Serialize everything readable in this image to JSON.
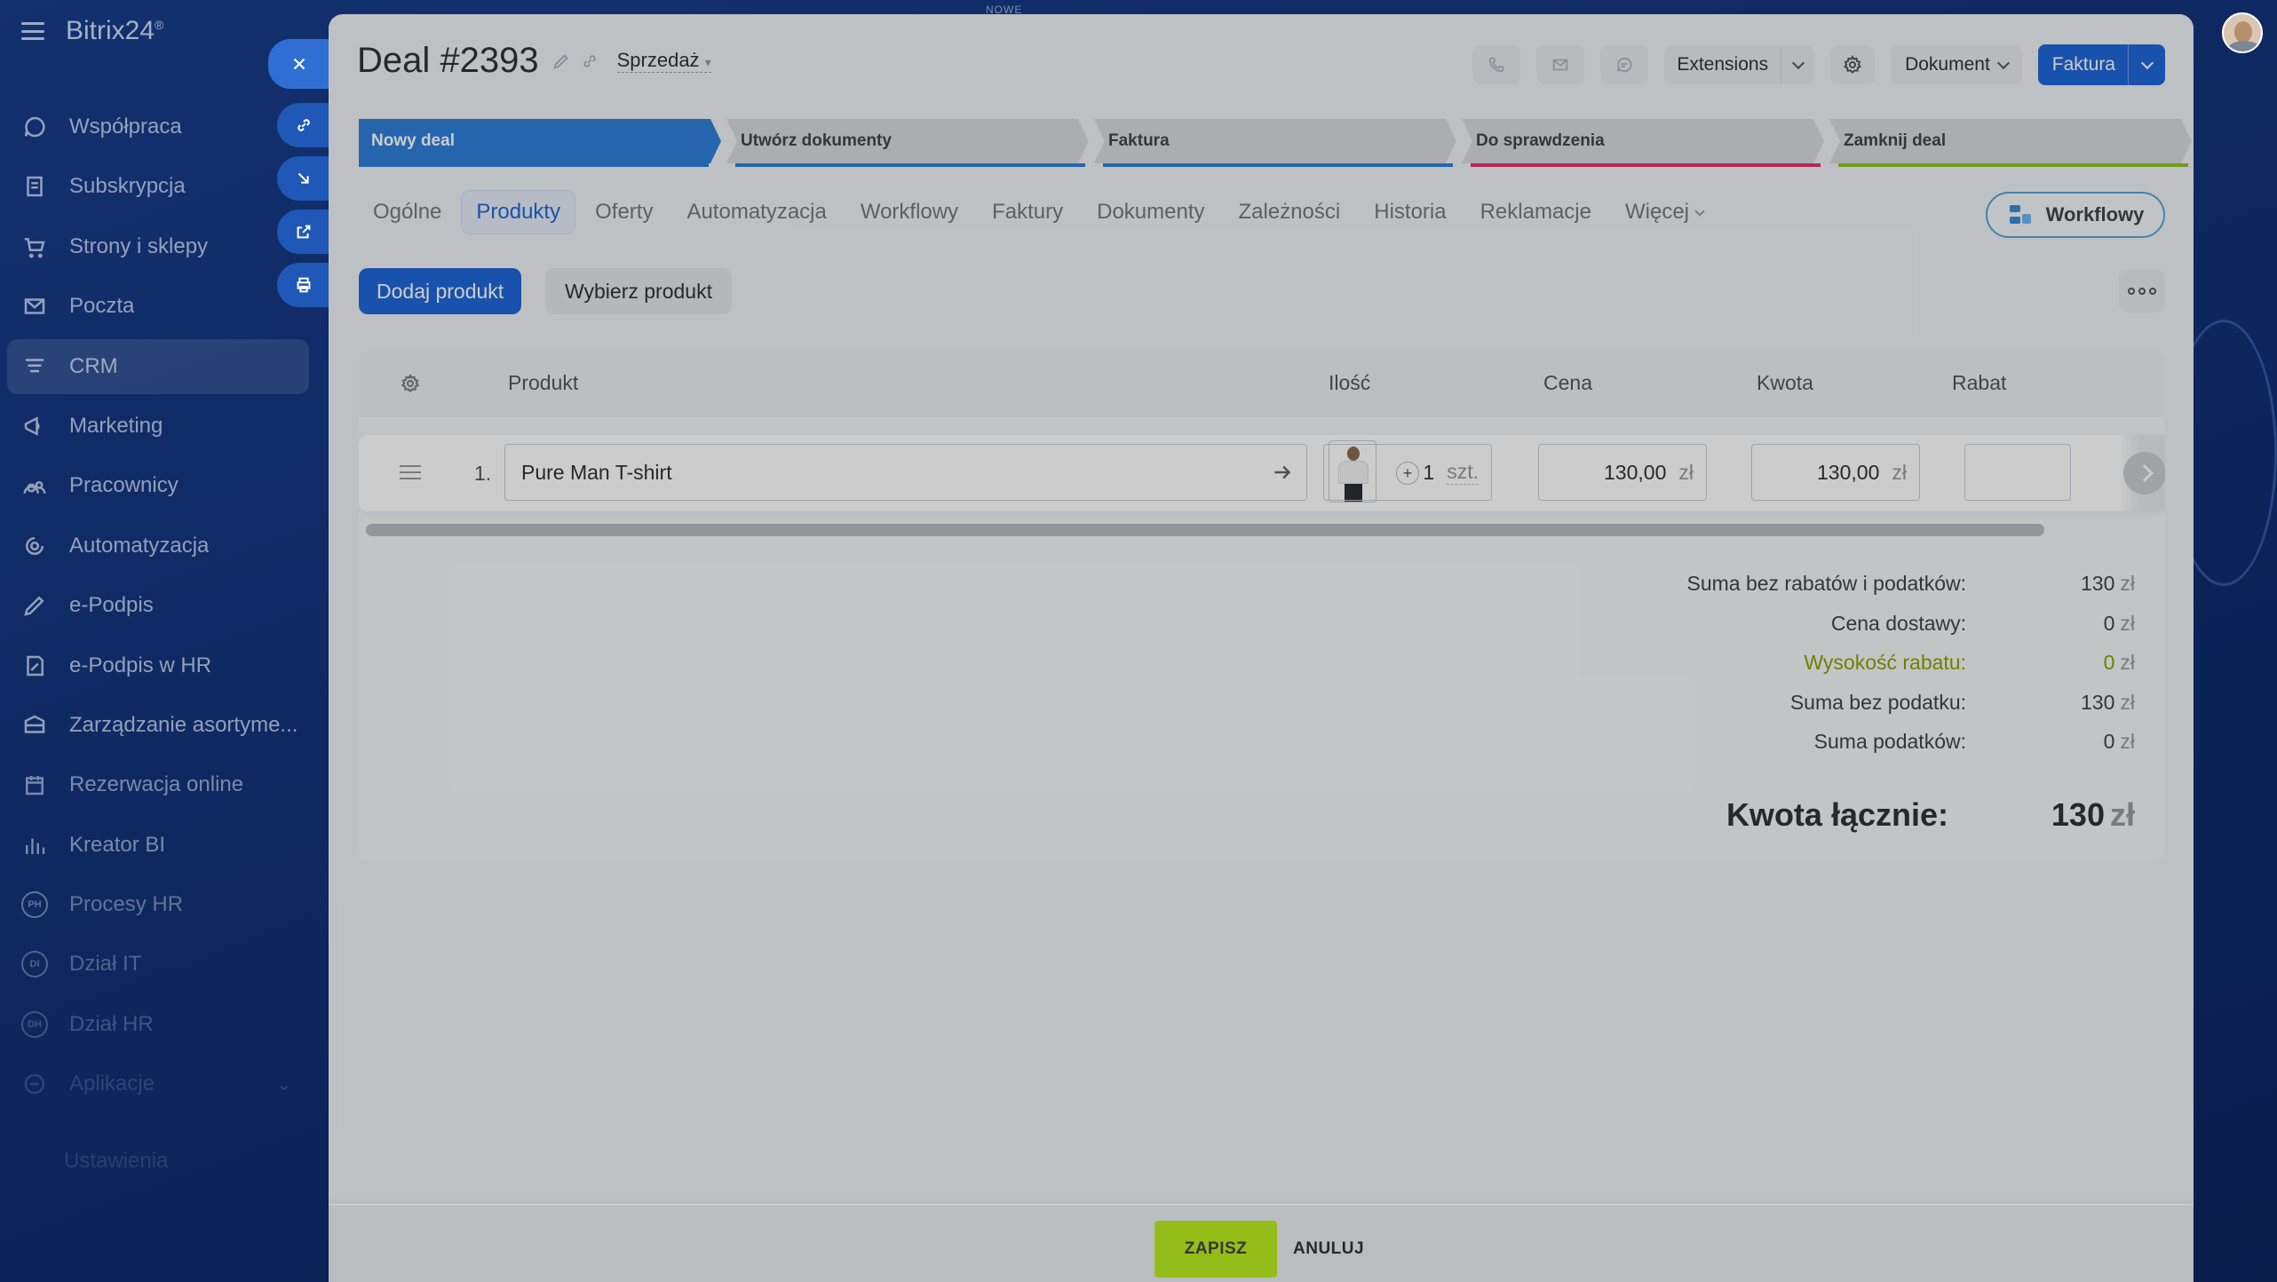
{
  "top_note": "NOWE",
  "sidebar": {
    "logo": "Bitrix24",
    "logo_badge": "®",
    "items": [
      {
        "label": "Współpraca",
        "icon": "chat-icon"
      },
      {
        "label": "Subskrypcja",
        "icon": "subscription-icon"
      },
      {
        "label": "Strony i sklepy",
        "icon": "cart-icon"
      },
      {
        "label": "Poczta",
        "icon": "mail-icon"
      },
      {
        "label": "CRM",
        "icon": "crm-icon",
        "active": true
      },
      {
        "label": "Marketing",
        "icon": "marketing-icon"
      },
      {
        "label": "Pracownicy",
        "icon": "employees-icon"
      },
      {
        "label": "Automatyzacja",
        "icon": "automation-icon"
      },
      {
        "label": "e-Podpis",
        "icon": "signature-icon"
      },
      {
        "label": "e-Podpis w HR",
        "icon": "hr-signature-icon"
      },
      {
        "label": "Zarządzanie asortyme...",
        "icon": "inventory-icon"
      },
      {
        "label": "Rezerwacja online",
        "icon": "booking-icon"
      },
      {
        "label": "Kreator BI",
        "icon": "bi-icon"
      },
      {
        "label": "Procesy HR",
        "icon": "ph-badge-icon",
        "badge": "PH"
      },
      {
        "label": "Dział IT",
        "icon": "di-badge-icon",
        "badge": "DI"
      },
      {
        "label": "Dział HR",
        "icon": "dh-badge-icon",
        "badge": "DH"
      },
      {
        "label": "Aplikacje",
        "icon": "apps-icon",
        "has_chevron": true
      }
    ],
    "bottom": "Ustawienia"
  },
  "deal": {
    "title": "Deal #2393",
    "category": "Sprzedaż"
  },
  "header_buttons": {
    "extensions": "Extensions",
    "dokument": "Dokument",
    "faktura": "Faktura"
  },
  "stages": [
    {
      "label": "Nowy deal",
      "color": "#2f7fd9",
      "line": "#2f7fd9"
    },
    {
      "label": "Utwórz dokumenty",
      "color": "#d6dadd",
      "line": "#2f7fd9"
    },
    {
      "label": "Faktura",
      "color": "#d6dadd",
      "line": "#2f7fd9"
    },
    {
      "label": "Do sprawdzenia",
      "color": "#d6dadd",
      "line": "#e0336b"
    },
    {
      "label": "Zamknij deal",
      "color": "#d6dadd",
      "line": "#8dc321"
    }
  ],
  "tabs": [
    {
      "label": "Ogólne"
    },
    {
      "label": "Produkty",
      "active": true
    },
    {
      "label": "Oferty"
    },
    {
      "label": "Automatyzacja"
    },
    {
      "label": "Workflowy"
    },
    {
      "label": "Faktury"
    },
    {
      "label": "Dokumenty"
    },
    {
      "label": "Zależności"
    },
    {
      "label": "Historia"
    },
    {
      "label": "Reklamacje"
    },
    {
      "label": "Więcej",
      "more": true
    }
  ],
  "workflow_button": "Workflowy",
  "actions": {
    "add_product": "Dodaj produkt",
    "pick_product": "Wybierz produkt"
  },
  "table": {
    "headers": {
      "product": "Produkt",
      "qty": "Ilość",
      "price": "Cena",
      "amount": "Kwota",
      "discount": "Rabat"
    },
    "rows": [
      {
        "num": "1.",
        "product": "Pure Man T-shirt",
        "qty": "1",
        "unit": "szt.",
        "price": "130,00",
        "amount": "130,00",
        "currency": "zł"
      }
    ]
  },
  "totals": {
    "currency": "zł",
    "rows": [
      {
        "label": "Suma bez rabatów i podatków:",
        "value": "130"
      },
      {
        "label": "Cena dostawy:",
        "value": "0"
      },
      {
        "label": "Wysokość rabatu:",
        "value": "0",
        "highlight": true
      },
      {
        "label": "Suma bez podatku:",
        "value": "130"
      },
      {
        "label": "Suma podatków:",
        "value": "0"
      }
    ],
    "total_label": "Kwota łącznie:",
    "total_value": "130"
  },
  "footer": {
    "save": "ZAPISZ",
    "cancel": "ANULUJ"
  }
}
